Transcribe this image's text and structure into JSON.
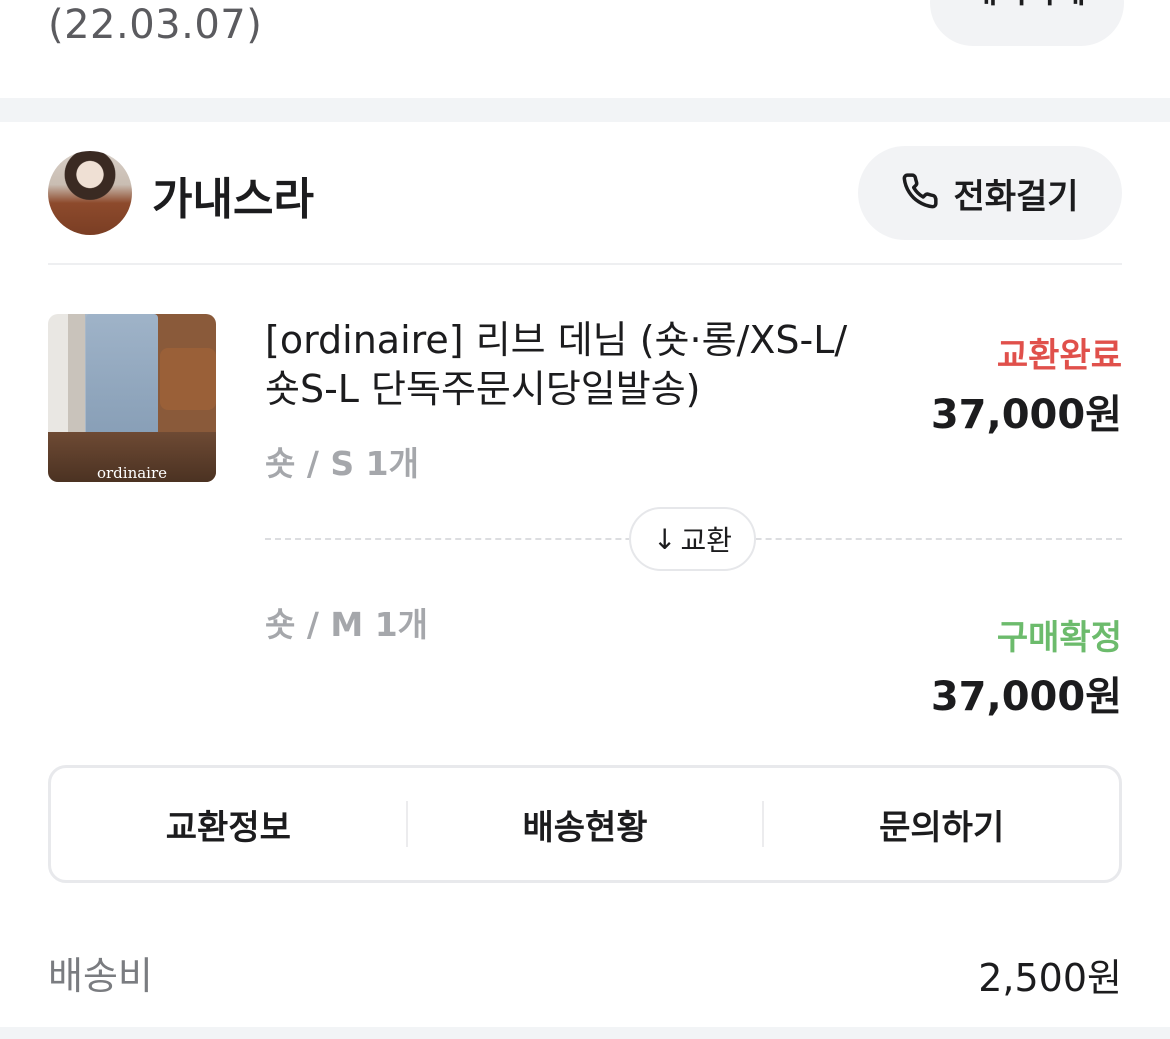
{
  "top": {
    "date": "(22.03.07)",
    "delete_button": "내역삭제"
  },
  "seller": {
    "name": "가내스라",
    "call_label": "전화걸기"
  },
  "product": {
    "brand_watermark": "ordinaire",
    "name": "[ordinaire] 리브 데님 (숏·롱/XS-L/숏S-L 단독주문시당일발송)",
    "original": {
      "option": "숏 / S 1개",
      "status": "교환완료",
      "status_color": "#e0504b",
      "price": "37,000원"
    },
    "exchange_chip": {
      "arrow": "↓",
      "label": "교환"
    },
    "replacement": {
      "option": "숏 / M 1개",
      "status": "구매확정",
      "status_color": "#6cbb6c",
      "price": "37,000원"
    }
  },
  "actions": [
    {
      "label": "교환정보"
    },
    {
      "label": "배송현황"
    },
    {
      "label": "문의하기"
    }
  ],
  "shipping": {
    "label": "배송비",
    "value": "2,500원"
  }
}
